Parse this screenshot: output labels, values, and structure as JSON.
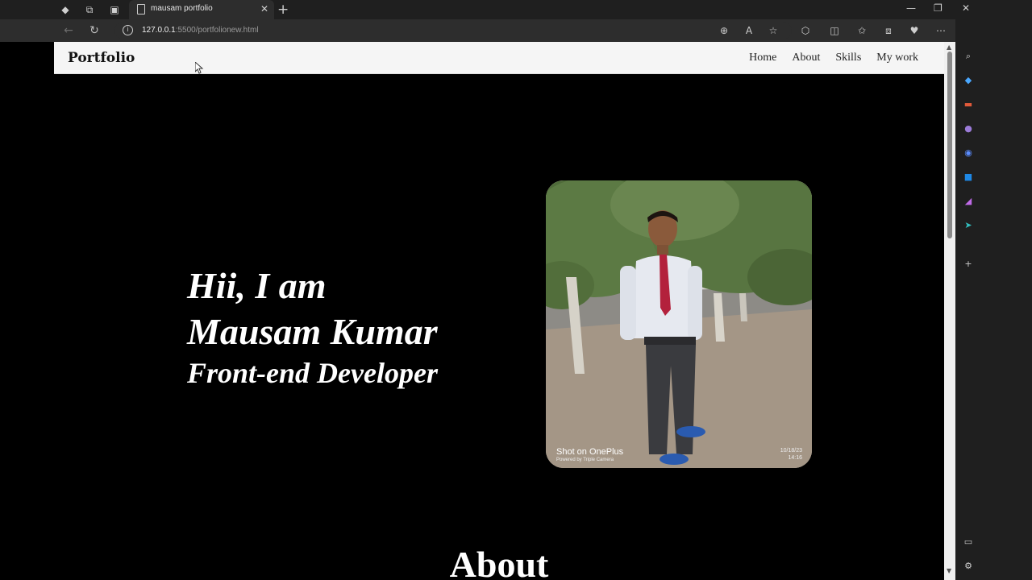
{
  "browser": {
    "tab_title": "mausam portfolio",
    "new_tab": "+",
    "url_host": "127.0.0.1",
    "url_path": ":5500/portfolionew.html"
  },
  "site": {
    "brand": "Portfolio",
    "nav": [
      "Home",
      "About",
      "Skills",
      "My work"
    ]
  },
  "hero": {
    "line1": "Hii, I am",
    "line2": "Mausam Kumar",
    "line3": "Front-end Developer"
  },
  "photo": {
    "watermark": "Shot on OnePlus",
    "watermark_sub": "Powered by Triple Camera",
    "date": "10/18/23",
    "time": "14:16"
  },
  "about": {
    "heading": "About"
  },
  "colors": {
    "page_background": "#000000",
    "navbar_background": "#f5f5f5",
    "hero_text": "#ffffff"
  }
}
